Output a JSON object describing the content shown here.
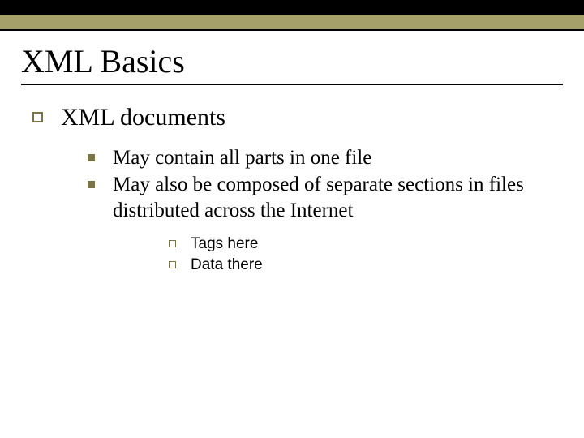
{
  "title": "XML Basics",
  "level1": {
    "text": "XML documents"
  },
  "level2": [
    {
      "text": "May contain all parts in one file"
    },
    {
      "text": "May also be composed of separate sections in files distributed across the Internet"
    }
  ],
  "level3": [
    {
      "text": "Tags here"
    },
    {
      "text": "Data there"
    }
  ]
}
